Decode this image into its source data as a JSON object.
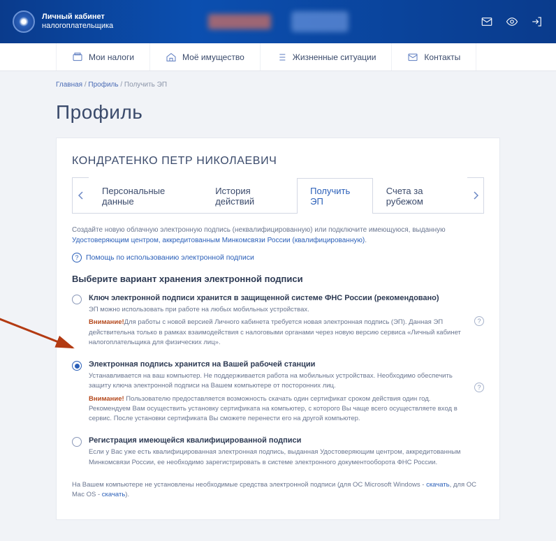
{
  "header": {
    "logo_line1": "Личный кабинет",
    "logo_line2": "налогоплательщика"
  },
  "nav": {
    "items": [
      {
        "label": "Мои налоги"
      },
      {
        "label": "Моё имущество"
      },
      {
        "label": "Жизненные ситуации"
      },
      {
        "label": "Контакты"
      }
    ]
  },
  "breadcrumb": {
    "home": "Главная",
    "sep": " / ",
    "profile": "Профиль",
    "current": "Получить ЭП"
  },
  "page_title": "Профиль",
  "user_name": "КОНДРАТЕНКО ПЕТР НИКОЛАЕВИЧ",
  "tabs": [
    {
      "label": "Персональные данные"
    },
    {
      "label": "История действий"
    },
    {
      "label": "Получить ЭП",
      "active": true
    },
    {
      "label": "Счета за рубежом"
    }
  ],
  "intro_text": "Создайте новую облачную электронную подпись (неквалифицированную) или подключите имеющуюся, выданную ",
  "intro_link": "Удостоверяющим центром, аккредитованным Минкомсвязи России (квалифицированную)",
  "intro_dot": ".",
  "help_text": "Помощь по использованию электронной подписи",
  "section_title": "Выберите вариант хранения электронной подписи",
  "options": [
    {
      "title": "Ключ электронной подписи хранится в защищенной системе ФНС России (рекомендовано)",
      "desc1": "ЭП можно использовать при работе на любых мобильных устройствах.",
      "warn": "Внимание!",
      "desc2": "Для работы с новой версией Личного кабинета требуется новая электронная подпись (ЭП). Данная ЭП действительна только в рамках взаимодействия с налоговыми органами через новую версию сервиса «Личный кабинет налогоплательщика для физических лиц».",
      "selected": false,
      "has_q": true
    },
    {
      "title": "Электронная подпись хранится на Вашей рабочей станции",
      "desc1": "Устанавливается на ваш компьютер. Не поддерживается работа на мобильных устройствах. Необходимо обеспечить защиту ключа электронной подписи на Вашем компьютере от посторонних лиц.",
      "warn": "Внимание!",
      "desc2": " Пользователю предоставляется возможность скачать один сертификат  сроком действия один год. Рекомендуем Вам осуществить установку сертификата на компьютер, с которого Вы  чаще всего осуществляете вход в сервис. После установки сертификата Вы сможете перенести его на другой  компьютер.",
      "selected": true,
      "has_q": true
    },
    {
      "title": "Регистрация имеющейся квалифицированной подписи",
      "desc1": "Если у Вас уже есть квалифицированная электронная подпись, выданная Удостоверяющим центром, аккредитованным Минкомсвязи России, ее необходимо зарегистрировать в системе электронного документооборота ФНС России.",
      "selected": false,
      "has_q": false
    }
  ],
  "footnote_pre": "На Вашем компьютере не установлены необходимые средства электронной подписи (для ОС Microsoft Windows - ",
  "footnote_link1": "скачать",
  "footnote_mid": ", для ОС Mac OS - ",
  "footnote_link2": "скачать",
  "footnote_end": ")."
}
